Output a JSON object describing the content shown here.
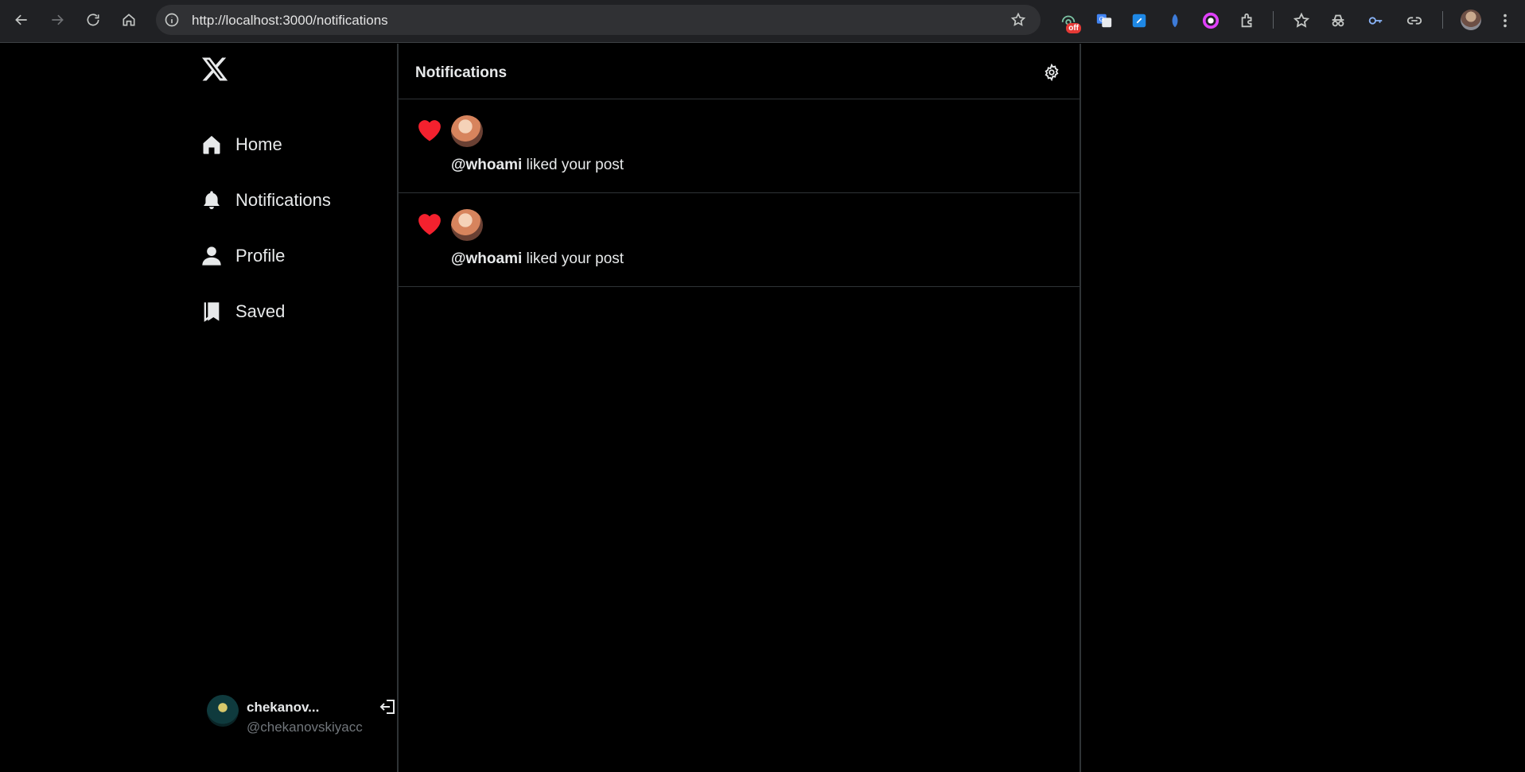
{
  "browser": {
    "url": "http://localhost:3000/notifications",
    "extension_badge": "off"
  },
  "sidebar": {
    "items": [
      {
        "label": "Home",
        "icon": "home-icon"
      },
      {
        "label": "Notifications",
        "icon": "bell-icon"
      },
      {
        "label": "Profile",
        "icon": "person-icon"
      },
      {
        "label": "Saved",
        "icon": "bookmark-icon"
      }
    ],
    "account": {
      "name": "chekanov...",
      "handle": "@chekanovskiyacc"
    }
  },
  "main": {
    "title": "Notifications",
    "notifications": [
      {
        "user": "@whoami",
        "action": " liked your post"
      },
      {
        "user": "@whoami",
        "action": " liked your post"
      }
    ]
  },
  "colors": {
    "background": "#000000",
    "heart": "#f4212e",
    "divider": "#2f3336",
    "muted_text": "#71767b"
  }
}
